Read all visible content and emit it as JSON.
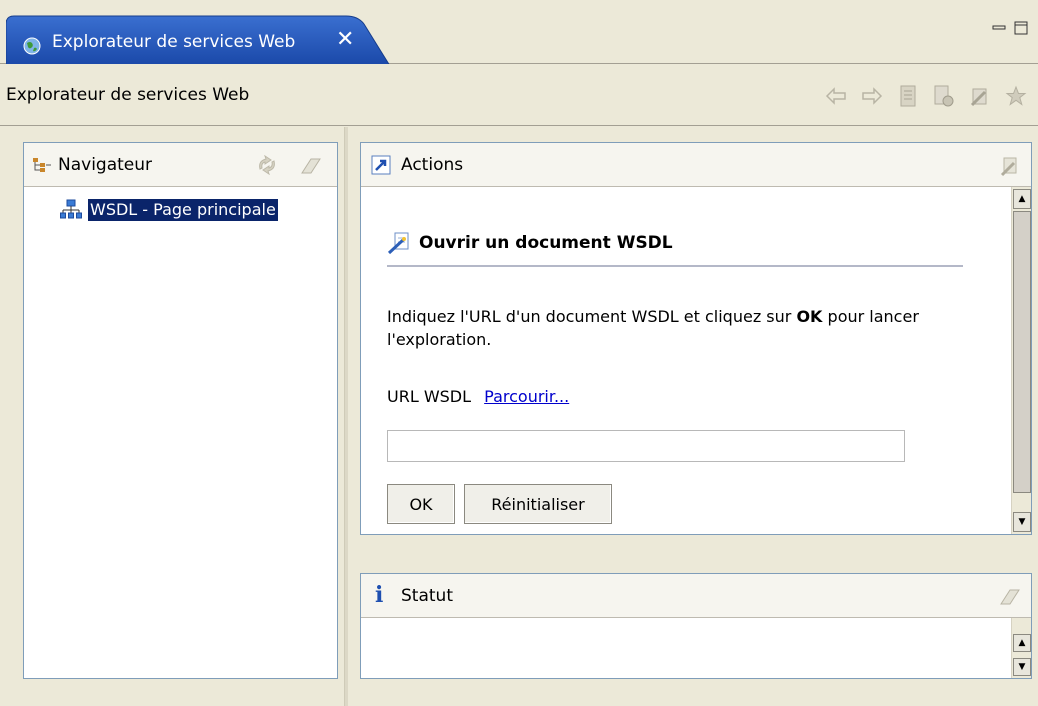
{
  "tab": {
    "title": "Explorateur de services Web",
    "close_glyph": "✕",
    "icon": "globe-icon"
  },
  "window_controls": {
    "minimize_icon": "minimize-icon",
    "maximize_icon": "maximize-icon"
  },
  "titlebar": {
    "title": "Explorateur de services Web",
    "toolbar_icons": [
      "back-arrow-icon",
      "forward-arrow-icon",
      "document-icon",
      "page-settings-icon",
      "wsdl-wand-icon",
      "favorites-star-icon"
    ]
  },
  "navigator": {
    "title": "Navigateur",
    "icons": [
      "navigator-tree-icon",
      "refresh-sync-icon",
      "eraser-icon"
    ],
    "items": [
      {
        "label": "WSDL - Page principale",
        "icon": "wsdl-tree-icon",
        "selected": true
      }
    ]
  },
  "actions": {
    "title": "Actions",
    "header_icon": "actions-arrow-icon",
    "corner_icon": "wand-icon",
    "section_title": "Ouvrir un document WSDL",
    "description_before": "Indiquez l'URL d'un document WSDL et cliquez sur ",
    "description_bold": "OK",
    "description_after": " pour lancer l'exploration.",
    "url_label": "URL WSDL",
    "browse_link": "Parcourir...",
    "url_value": "",
    "ok_label": "OK",
    "reset_label": "Réinitialiser"
  },
  "statut": {
    "title": "Statut",
    "info_glyph": "i",
    "corner_icon": "eraser-icon"
  },
  "colors": {
    "tab_active": "#1e4fb0",
    "selection": "#0a246a",
    "link": "#0000cc",
    "panel_border": "#7f9db9",
    "background": "#ece9d8"
  }
}
